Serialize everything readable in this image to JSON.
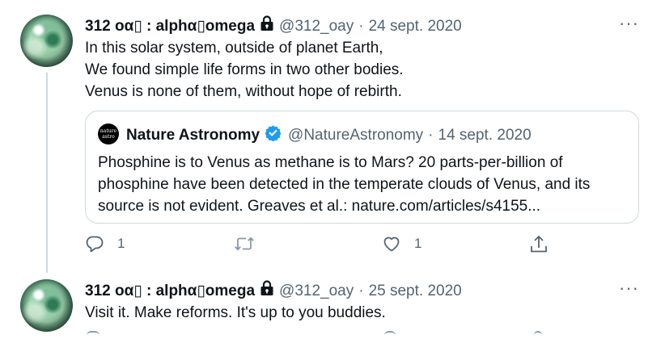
{
  "tweet1": {
    "name": "312 οα▯ : alphα▯omega",
    "handle": "@312_oay",
    "separator": "·",
    "date": "24 sept. 2020",
    "more": "···",
    "lines": [
      "In this solar system, outside of planet Earth,",
      "We found simple life forms in two other bodies.",
      "Venus is none of them, without hope of rebirth."
    ],
    "quote": {
      "logo_line1": "nature",
      "logo_line2": "astro",
      "name": "Nature Astronomy",
      "handle": "@NatureAstronomy",
      "separator": "·",
      "date": "14 sept. 2020",
      "lines": [
        "Phosphine is to Venus as methane is to Mars? 20 parts-per-billion of",
        "phosphine have been detected in the temperate clouds of Venus, and its",
        "source is not evident. Greaves et al.: nature.com/articles/s4155..."
      ]
    },
    "actions": {
      "reply_count": "1",
      "retweet_count": "",
      "like_count": "1"
    }
  },
  "tweet2": {
    "name": "312 οα▯ : alphα▯omega",
    "handle": "@312_oay",
    "separator": "·",
    "date": "25 sept. 2020",
    "more": "···",
    "lines": [
      "Visit it. Make reforms. It's up to you buddies."
    ]
  },
  "icons": {
    "lock": "lock-icon",
    "verified": "verified-badge-icon",
    "reply": "reply-icon",
    "retweet": "retweet-icon",
    "like": "like-icon",
    "share": "share-icon",
    "more": "more-icon"
  },
  "colors": {
    "text": "#0f1419",
    "secondary": "#536471",
    "border": "#cfd9de",
    "verified": "#1d9bf0"
  }
}
